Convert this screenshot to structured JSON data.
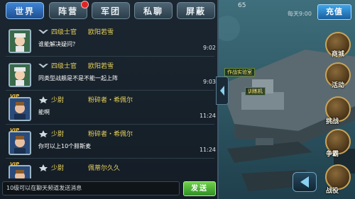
{
  "tabs": [
    {
      "label": "世界",
      "active": true
    },
    {
      "label": "阵营",
      "active": false,
      "has_alert": true
    },
    {
      "label": "军团",
      "active": false
    },
    {
      "label": "私聊",
      "active": false
    },
    {
      "label": "屏蔽",
      "active": false
    }
  ],
  "messages": [
    {
      "vip": "",
      "rank": "四级士官",
      "nick": "欧阳若雪",
      "text": "谁能解决疑问？",
      "time": "9:02"
    },
    {
      "vip": "",
      "rank": "四级士官",
      "nick": "欧阳若雪",
      "text": "同类型战舰是不是不能一起上阵",
      "time": "9:03"
    },
    {
      "vip": "VIP",
      "rank": "少尉",
      "nick": "粉碎者・希佩尔",
      "text": "能啊",
      "time": "11:24"
    },
    {
      "vip": "VIP",
      "rank": "少尉",
      "nick": "粉碎者・希佩尔",
      "text": "你可以上10个腓斯麦",
      "time": "11:24"
    },
    {
      "vip": "VIP",
      "rank": "少尉",
      "nick": "佩蒂尔久久",
      "text": "",
      "time": ""
    }
  ],
  "input": {
    "placeholder": "10级可以在聊天频道发送消息"
  },
  "send_label": "发送",
  "game": {
    "top_number": "65",
    "daily": "每天9:00",
    "recharge": "充值",
    "side_buttons": [
      "商城",
      "活动",
      "挑战",
      "争霸",
      "战役"
    ],
    "map_labels": [
      "作战实验室",
      "训练机"
    ]
  },
  "colors": {
    "accent": "#3e85d6",
    "gold": "#e8d25a",
    "send": "#2f8f24"
  }
}
